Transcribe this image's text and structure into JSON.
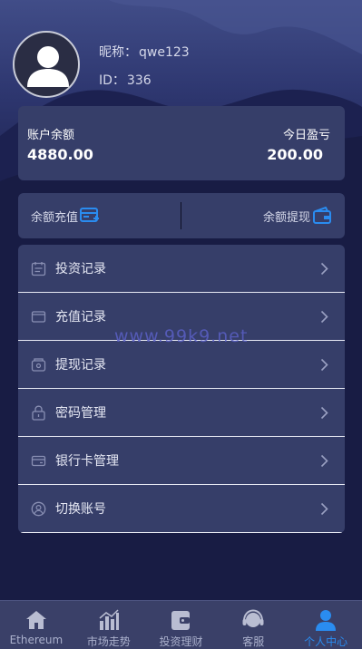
{
  "profile": {
    "nickname_label": "昵称：",
    "nickname": "qwe123",
    "id_label": "ID：",
    "id": "336"
  },
  "balance": {
    "account_label": "账户余额",
    "account_value": "4880.00",
    "today_label": "今日盈亏",
    "today_value": "200.00"
  },
  "actions": {
    "recharge_label": "余额充值",
    "withdraw_label": "余额提现"
  },
  "menu": [
    {
      "label": "投资记录",
      "icon": "calendar-icon"
    },
    {
      "label": "充值记录",
      "icon": "wallet-icon"
    },
    {
      "label": "提现记录",
      "icon": "withdraw-icon"
    },
    {
      "label": "密码管理",
      "icon": "lock-icon"
    },
    {
      "label": "银行卡管理",
      "icon": "bank-card-icon"
    },
    {
      "label": "切换账号",
      "icon": "user-circle-icon"
    }
  ],
  "watermark": "www.99k9.net",
  "tabbar": [
    {
      "label": "Ethereum",
      "icon": "home-icon",
      "active": false
    },
    {
      "label": "市场走势",
      "icon": "bar-chart-icon",
      "active": false
    },
    {
      "label": "投资理财",
      "icon": "wallet-icon",
      "active": false
    },
    {
      "label": "客服",
      "icon": "headset-icon",
      "active": false
    },
    {
      "label": "个人中心",
      "icon": "user-icon",
      "active": true
    }
  ],
  "colors": {
    "accent": "#2a8cf0",
    "card": "#363e69",
    "background": "#161a3a"
  }
}
